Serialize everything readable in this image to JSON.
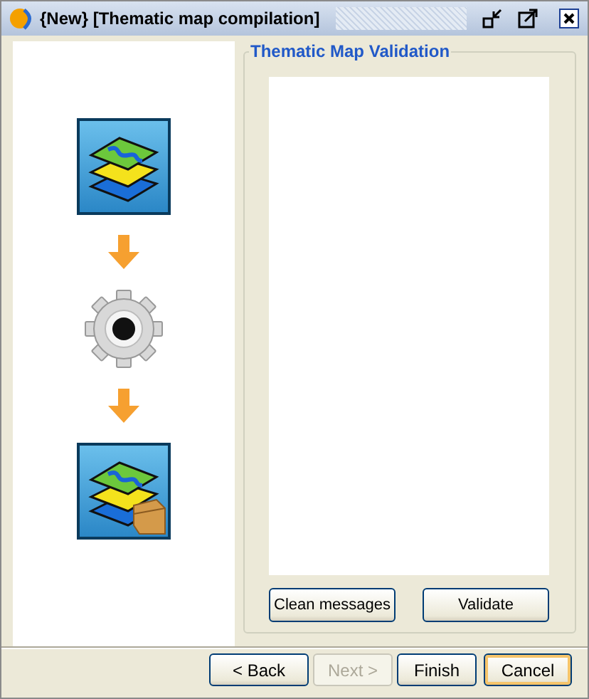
{
  "window": {
    "title": "{New} [Thematic map compilation]"
  },
  "steps": [
    {
      "kind": "map-layers"
    },
    {
      "kind": "arrow"
    },
    {
      "kind": "gear"
    },
    {
      "kind": "arrow"
    },
    {
      "kind": "map-package"
    }
  ],
  "validation": {
    "title": "Thematic Map Validation",
    "buttons": [
      "Clean messages",
      "Validate"
    ]
  },
  "wizard_buttons": [
    {
      "label": "< Back",
      "disabled": false,
      "focused": false
    },
    {
      "label": "Next >",
      "disabled": true,
      "focused": false
    },
    {
      "label": "Finish",
      "disabled": false,
      "focused": false
    },
    {
      "label": "Cancel",
      "disabled": false,
      "focused": true
    }
  ]
}
